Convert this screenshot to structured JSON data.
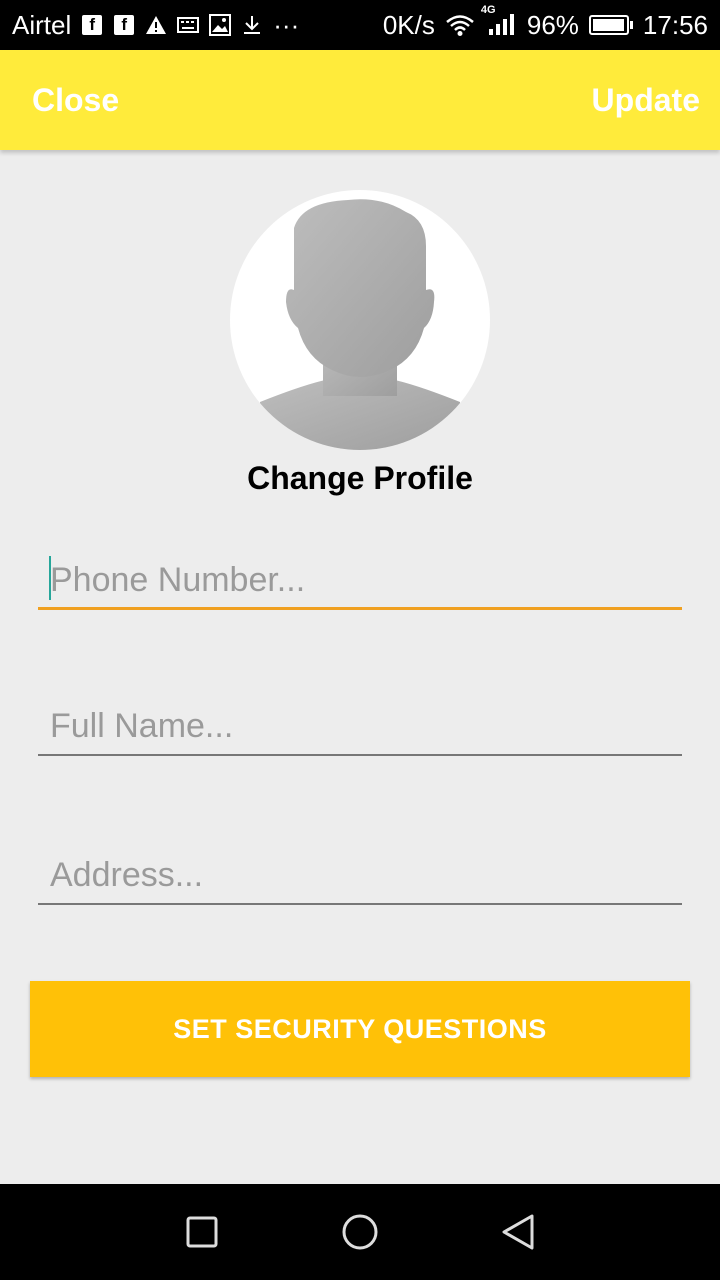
{
  "status_bar": {
    "carrier": "Airtel",
    "speed": "0K/s",
    "network": "4G",
    "battery": "96%",
    "battery_level": 0.96,
    "time": "17:56",
    "more": "···",
    "icons": [
      "facebook-icon",
      "facebook-icon",
      "warning-icon",
      "keyboard-icon",
      "image-icon",
      "download-icon",
      "wifi-icon",
      "signal-icon",
      "battery-icon"
    ]
  },
  "toolbar": {
    "close_label": "Close",
    "update_label": "Update",
    "background": "#ffeb3b"
  },
  "profile": {
    "avatar_icon": "default-avatar-icon",
    "change_label": "Change Profile"
  },
  "form": {
    "phone": {
      "value": "",
      "placeholder": "Phone Number..."
    },
    "full_name": {
      "value": "",
      "placeholder": "Full Name..."
    },
    "address": {
      "value": "",
      "placeholder": "Address..."
    },
    "focus_color": "#f0a020"
  },
  "security_button": {
    "label": "SET SECURITY QUESTIONS",
    "color": "#ffc107"
  },
  "nav_bar": {
    "icons": [
      "recents-icon",
      "home-icon",
      "back-icon"
    ]
  }
}
